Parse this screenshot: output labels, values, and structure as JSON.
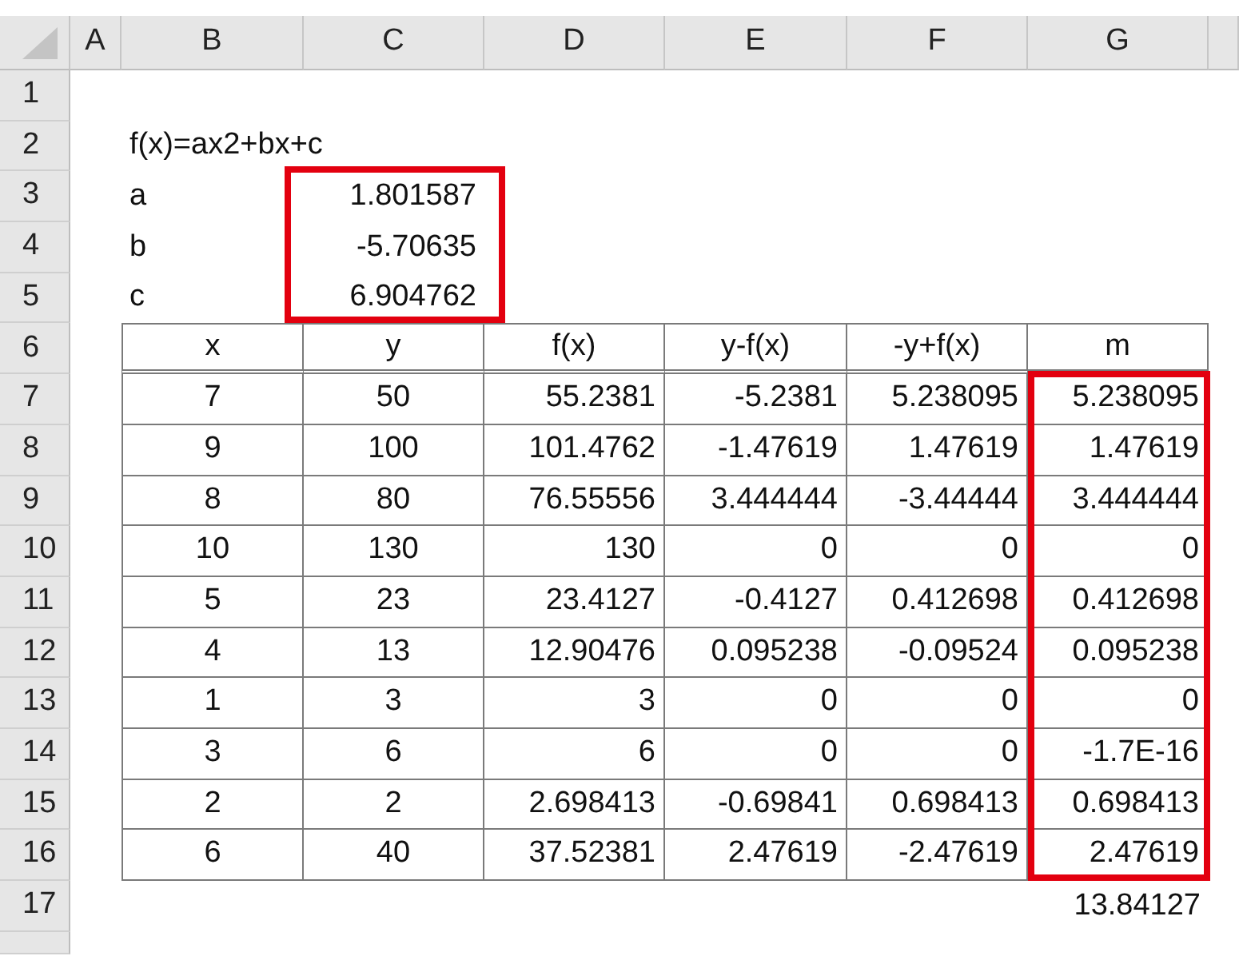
{
  "column_headers": [
    "A",
    "B",
    "C",
    "D",
    "E",
    "F",
    "G"
  ],
  "row_numbers": [
    "1",
    "2",
    "3",
    "4",
    "5",
    "6",
    "7",
    "8",
    "9",
    "10",
    "11",
    "12",
    "13",
    "14",
    "15",
    "16",
    "17"
  ],
  "formula": "f(x)=ax2+bx+c",
  "parameters": [
    {
      "name": "a",
      "value": "1.801587"
    },
    {
      "name": "b",
      "value": "-5.70635"
    },
    {
      "name": "c",
      "value": "6.904762"
    }
  ],
  "table": {
    "columns": [
      "x",
      "y",
      "f(x)",
      "y-f(x)",
      "-y+f(x)",
      "m"
    ],
    "rows": [
      [
        "7",
        "50",
        "55.2381",
        "-5.2381",
        "5.238095",
        "5.238095"
      ],
      [
        "9",
        "100",
        "101.4762",
        "-1.47619",
        "1.47619",
        "1.47619"
      ],
      [
        "8",
        "80",
        "76.55556",
        "3.444444",
        "-3.44444",
        "3.444444"
      ],
      [
        "10",
        "130",
        "130",
        "0",
        "0",
        "0"
      ],
      [
        "5",
        "23",
        "23.4127",
        "-0.4127",
        "0.412698",
        "0.412698"
      ],
      [
        "4",
        "13",
        "12.90476",
        "0.095238",
        "-0.09524",
        "0.095238"
      ],
      [
        "1",
        "3",
        "3",
        "0",
        "0",
        "0"
      ],
      [
        "3",
        "6",
        "6",
        "0",
        "0",
        "-1.7E-16"
      ],
      [
        "2",
        "2",
        "2.698413",
        "-0.69841",
        "0.698413",
        "0.698413"
      ],
      [
        "6",
        "40",
        "37.52381",
        "2.47619",
        "-2.47619",
        "2.47619"
      ]
    ]
  },
  "total": "13.84127",
  "parameters_highlighted": true,
  "m_column_highlighted": true
}
